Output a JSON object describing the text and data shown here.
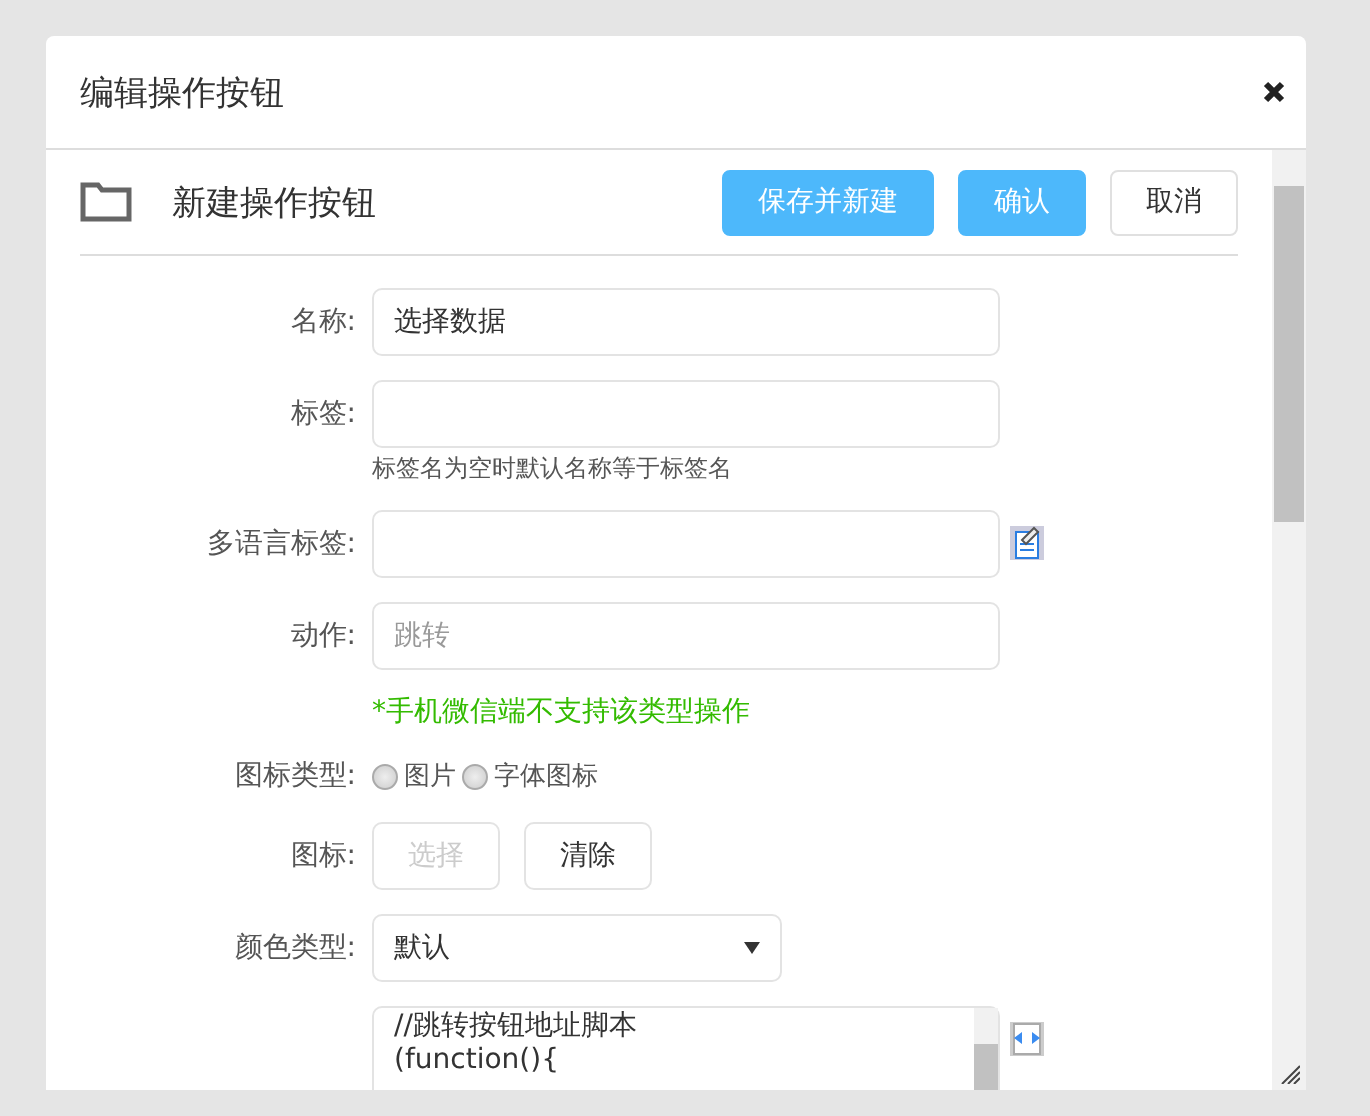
{
  "dialog": {
    "title": "编辑操作按钮"
  },
  "header": {
    "title": "新建操作按钮",
    "buttons": [
      {
        "label": "保存并新建",
        "kind": "primary"
      },
      {
        "label": "确认",
        "kind": "primary"
      },
      {
        "label": "取消",
        "kind": "default"
      }
    ]
  },
  "form": [
    {
      "kind": "text",
      "label": "名称:",
      "value": "选择数据"
    },
    {
      "kind": "text",
      "label": "标签:",
      "hint": "标签名为空时默认名称等于标签名"
    },
    {
      "kind": "multilang",
      "label": "多语言标签:"
    },
    {
      "kind": "text",
      "label": "动作:",
      "value": "跳转",
      "disabled": true
    },
    {
      "kind": "note",
      "text": "*手机微信端不支持该类型操作"
    },
    {
      "kind": "radio",
      "label": "图标类型:",
      "options": [
        {
          "label": "图片",
          "selected": false
        },
        {
          "label": "字体图标",
          "selected": false
        }
      ]
    },
    {
      "kind": "buttons",
      "label": "图标:",
      "buttons": [
        {
          "label": "选择",
          "disabled": true
        },
        {
          "label": "清除",
          "disabled": false
        }
      ]
    },
    {
      "kind": "select",
      "label": "颜色类型:",
      "value": "默认"
    },
    {
      "kind": "code",
      "lines": [
        "//跳转按钮地址脚本",
        "(function(){"
      ]
    }
  ]
}
